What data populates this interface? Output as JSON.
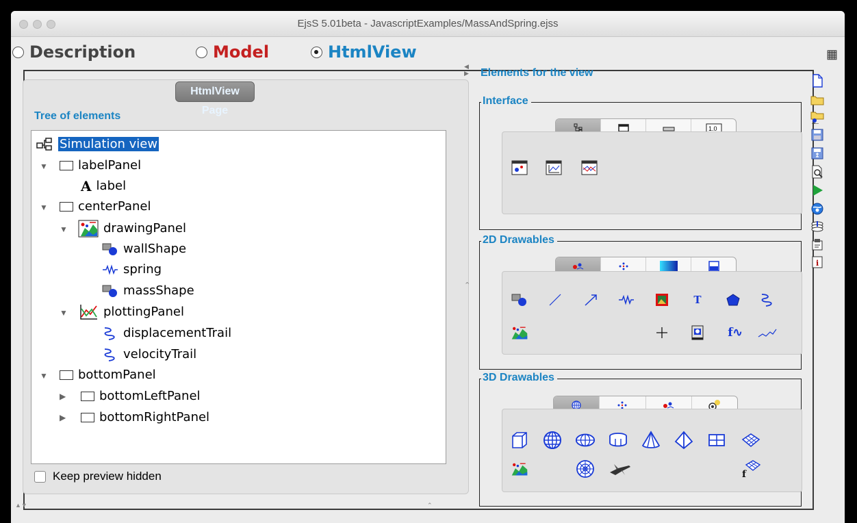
{
  "window": {
    "title": "EjsS 5.01beta - JavascriptExamples/MassAndSpring.ejss"
  },
  "modes": [
    {
      "label": "Description",
      "selected": false,
      "color": "#444444"
    },
    {
      "label": "Model",
      "selected": false,
      "color": "#c42020"
    },
    {
      "label": "HtmlView",
      "selected": true,
      "color": "#1b84c3"
    }
  ],
  "left": {
    "page_tab": "HtmlView Page",
    "tree_header": "Tree of elements",
    "tree": [
      {
        "label": "Simulation view",
        "icon": "tree-icon",
        "selected": true,
        "expanded": null
      },
      {
        "label": "labelPanel",
        "icon": "panel-icon",
        "expanded": true
      },
      {
        "label": "label",
        "icon": "label-icon",
        "expanded": null
      },
      {
        "label": "centerPanel",
        "icon": "panel-icon",
        "expanded": true
      },
      {
        "label": "drawingPanel",
        "icon": "drawing-panel-icon",
        "expanded": true
      },
      {
        "label": "wallShape",
        "icon": "shape-icon",
        "expanded": null
      },
      {
        "label": "spring",
        "icon": "spring-icon",
        "expanded": null
      },
      {
        "label": "massShape",
        "icon": "shape-icon",
        "expanded": null
      },
      {
        "label": "plottingPanel",
        "icon": "plotting-panel-icon",
        "expanded": true
      },
      {
        "label": "displacementTrail",
        "icon": "trail-icon",
        "expanded": null
      },
      {
        "label": "velocityTrail",
        "icon": "trail-icon",
        "expanded": null
      },
      {
        "label": "bottomPanel",
        "icon": "panel-icon",
        "expanded": true
      },
      {
        "label": "bottomLeftPanel",
        "icon": "panel-icon",
        "expanded": false
      },
      {
        "label": "bottomRightPanel",
        "icon": "panel-icon",
        "expanded": false
      }
    ],
    "keep_hidden_label": "Keep preview hidden",
    "keep_hidden_checked": false
  },
  "right": {
    "header": "Elements for the view",
    "groups": [
      {
        "title": "Interface",
        "tabs": [
          "tree-tab-icon",
          "window-tab-icon",
          "slider-tab-icon",
          "number-field-tab-icon"
        ],
        "active_tab": 0
      },
      {
        "title": "2D Drawables",
        "tabs": [
          "drawables-tab-icon",
          "particles-tab-icon",
          "field-tab-icon",
          "container-tab-icon"
        ],
        "active_tab": 0
      },
      {
        "title": "3D Drawables",
        "tabs": [
          "sphere-tab-icon",
          "particles3d-tab-icon",
          "drawables3d-tab-icon",
          "light-tab-icon"
        ],
        "active_tab": 0
      }
    ]
  },
  "colors": {
    "accent": "#1b84c3",
    "selection": "#1565c0",
    "model": "#c42020",
    "palette_blue": "#1a3bd6"
  }
}
